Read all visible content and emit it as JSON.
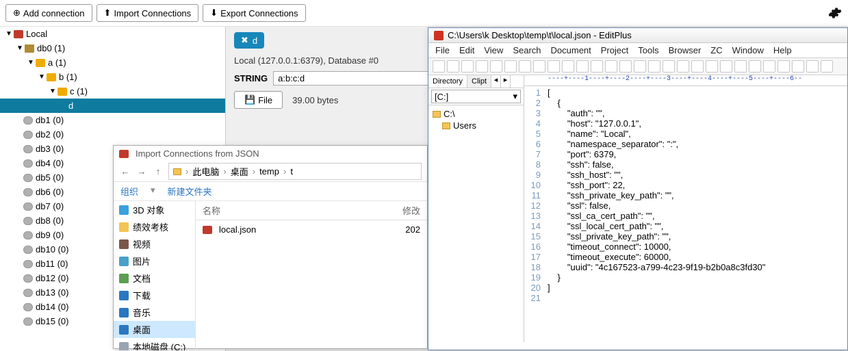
{
  "toolbar": {
    "add": "Add connection",
    "import": "Import Connections",
    "export": "Export Connections"
  },
  "tree": {
    "root": "Local",
    "db0": "db0 (1)",
    "a": "a (1)",
    "b": "b (1)",
    "c": "c (1)",
    "d": "d",
    "dbs": [
      "db1 (0)",
      "db2 (0)",
      "db3 (0)",
      "db4 (0)",
      "db5 (0)",
      "db6 (0)",
      "db7 (0)",
      "db8 (0)",
      "db9 (0)",
      "db10 (0)",
      "db11 (0)",
      "db12 (0)",
      "db13 (0)",
      "db14 (0)",
      "db15 (0)"
    ]
  },
  "key": {
    "tab": "d",
    "info": "Local (127.0.0.1:6379), Database #0",
    "type": "STRING",
    "value": "a:b:c:d",
    "file_btn": "File",
    "bytes": "39.00 bytes"
  },
  "dialog": {
    "title": "Import Connections from JSON",
    "crumbs": [
      "此电脑",
      "桌面",
      "temp",
      "t"
    ],
    "bar": {
      "org": "组织",
      "newf": "新建文件夹"
    },
    "side": [
      {
        "label": "3D 对象",
        "color": "#3aa0de"
      },
      {
        "label": "绩效考核",
        "color": "#f3c552"
      },
      {
        "label": "视频",
        "color": "#7a564a"
      },
      {
        "label": "图片",
        "color": "#49a0c8"
      },
      {
        "label": "文档",
        "color": "#5c9e52"
      },
      {
        "label": "下载",
        "color": "#2a77c4"
      },
      {
        "label": "音乐",
        "color": "#2a77c4"
      },
      {
        "label": "桌面",
        "color": "#2a77c4",
        "sel": true
      },
      {
        "label": "本地磁盘 (C:)",
        "color": "#9aa5b1"
      }
    ],
    "cols": {
      "name": "名称",
      "mod": "修改"
    },
    "file": {
      "name": "local.json",
      "mod": "202"
    }
  },
  "ep": {
    "title": "C:\\Users\\k              Desktop\\temp\\t\\local.json - EditPlus",
    "menu": [
      "File",
      "Edit",
      "View",
      "Search",
      "Document",
      "Project",
      "Tools",
      "Browser",
      "ZC",
      "Window",
      "Help"
    ],
    "side_tabs": {
      "dir": "Directory",
      "clip": "Clipt"
    },
    "drive": "[C:]",
    "tree": [
      "C:\\",
      "Users"
    ],
    "ruler": "----+----1----+----2----+----3----+----4----+----5----+----6--",
    "code": [
      "[",
      "    {",
      "        \"auth\": \"\",",
      "        \"host\": \"127.0.0.1\",",
      "        \"name\": \"Local\",",
      "        \"namespace_separator\": \":\",",
      "        \"port\": 6379,",
      "        \"ssh\": false,",
      "        \"ssh_host\": \"\",",
      "        \"ssh_port\": 22,",
      "        \"ssh_private_key_path\": \"\",",
      "        \"ssl\": false,",
      "        \"ssl_ca_cert_path\": \"\",",
      "        \"ssl_local_cert_path\": \"\",",
      "        \"ssl_private_key_path\": \"\",",
      "        \"timeout_connect\": 10000,",
      "        \"timeout_execute\": 60000,",
      "        \"uuid\": \"4c167523-a799-4c23-9f19-b2b0a8c3fd30\"",
      "    }",
      "]",
      ""
    ]
  },
  "chart_data": {
    "type": "table",
    "title": "local.json",
    "rows": [
      {
        "auth": ""
      },
      {
        "host": "127.0.0.1"
      },
      {
        "name": "Local"
      },
      {
        "namespace_separator": ":"
      },
      {
        "port": 6379
      },
      {
        "ssh": false
      },
      {
        "ssh_host": ""
      },
      {
        "ssh_port": 22
      },
      {
        "ssh_private_key_path": ""
      },
      {
        "ssl": false
      },
      {
        "ssl_ca_cert_path": ""
      },
      {
        "ssl_local_cert_path": ""
      },
      {
        "ssl_private_key_path": ""
      },
      {
        "timeout_connect": 10000
      },
      {
        "timeout_execute": 60000
      },
      {
        "uuid": "4c167523-a799-4c23-9f19-b2b0a8c3fd30"
      }
    ]
  }
}
